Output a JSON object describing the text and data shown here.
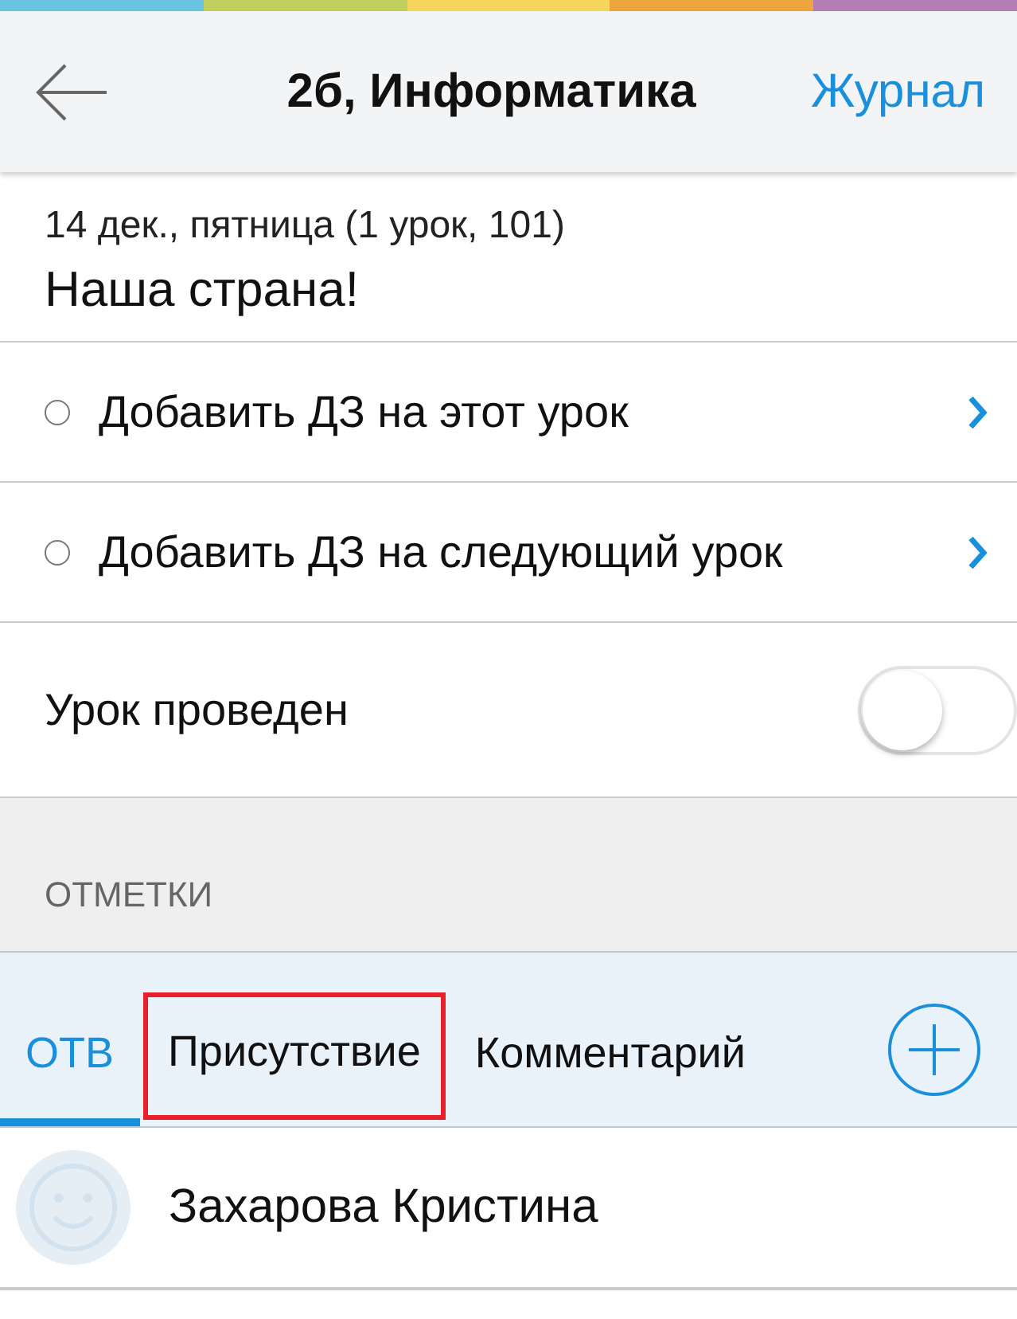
{
  "color_stripe": [
    {
      "color": "#6ac4e0"
    },
    {
      "color": "#c0cf5b"
    },
    {
      "color": "#f5d55a"
    },
    {
      "color": "#eda63f"
    },
    {
      "color": "#b57db5"
    }
  ],
  "header": {
    "title": "2б, Информатика",
    "action": "Журнал"
  },
  "lesson": {
    "date": "14 дек., пятница (1 урок, 101)",
    "topic": "Наша страна!"
  },
  "homework_rows": [
    {
      "label": "Добавить ДЗ на этот урок",
      "done": false
    },
    {
      "label": "Добавить ДЗ на следующий урок",
      "done": false
    }
  ],
  "lesson_done": {
    "label": "Урок проведен",
    "on": false
  },
  "marks_section": {
    "title": "ОТМЕТКИ"
  },
  "tabs": [
    {
      "label": "ОТВ",
      "selected": true,
      "highlighted": false
    },
    {
      "label": "Присутствие",
      "selected": false,
      "highlighted": true
    },
    {
      "label": "Комментарий",
      "selected": false,
      "highlighted": false
    }
  ],
  "students": [
    {
      "name": "Захарова Кристина"
    }
  ]
}
